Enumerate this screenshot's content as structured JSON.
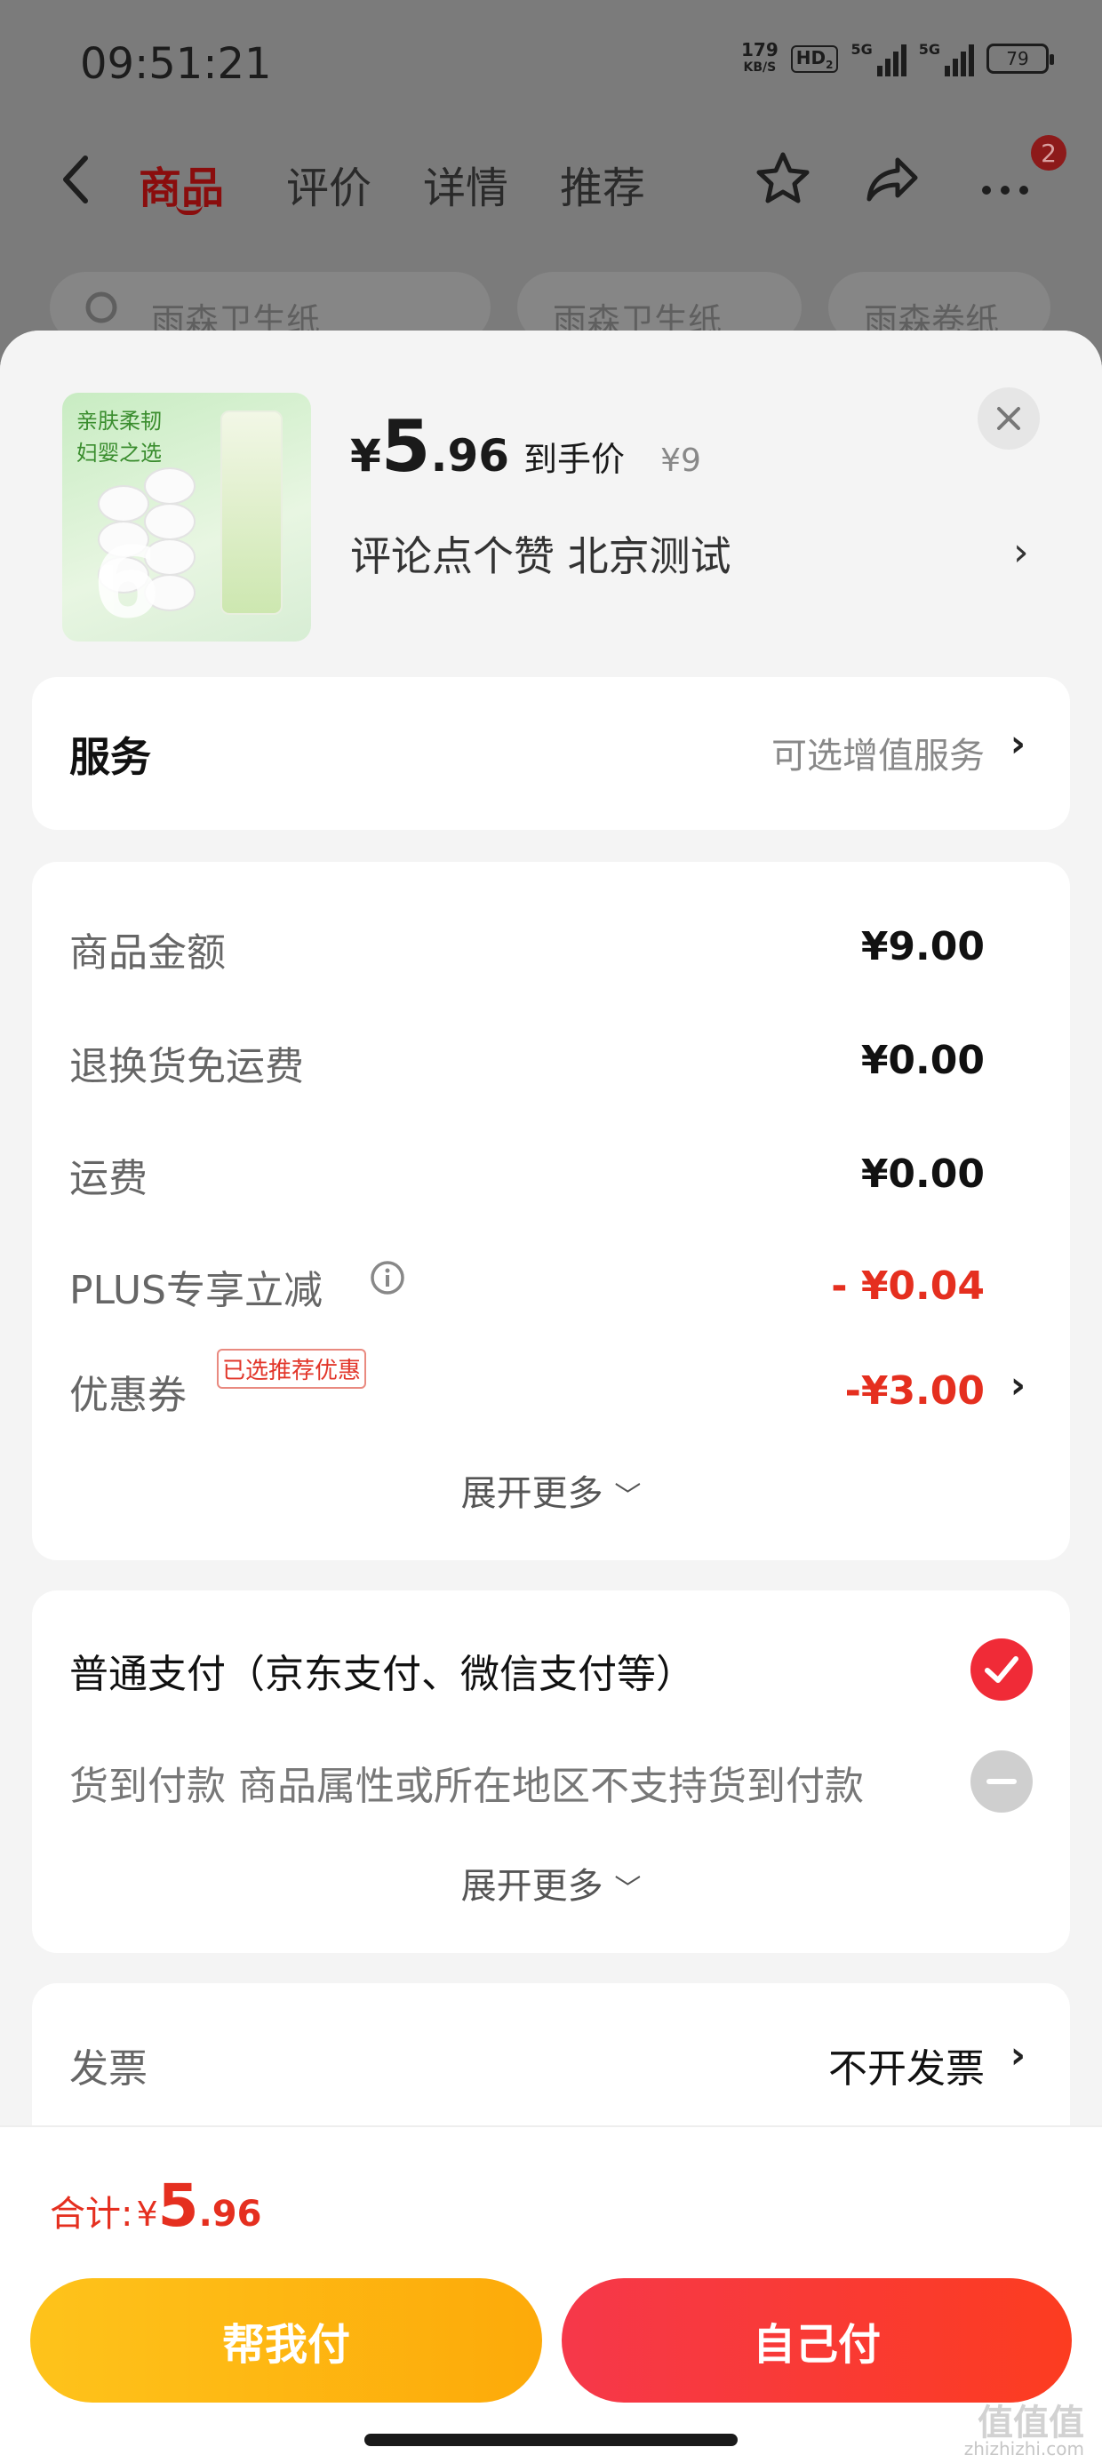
{
  "status_bar": {
    "time": "09:51:21",
    "net_speed": "179",
    "net_unit": "KB/S",
    "hd": "HD",
    "hd_sub": "2",
    "sim1": "5G",
    "sim2": "5G",
    "battery": "79"
  },
  "nav": {
    "tabs": [
      "商品",
      "评价",
      "详情",
      "推荐"
    ],
    "badge": "2"
  },
  "bg_chips": [
    "雨森卫生纸",
    "雨森卫生纸",
    "雨森卷纸"
  ],
  "product": {
    "thumb_text1": "亲肤柔韧",
    "thumb_text2": "妇婴之选",
    "thumb_number": "6",
    "price_symbol": "¥",
    "price_int": "5",
    "price_dec": ".96",
    "price_label": "到手价",
    "orig_price": "¥9",
    "subtitle": "评论点个赞  北京测试"
  },
  "service": {
    "title": "服务",
    "value": "可选增值服务"
  },
  "amounts": {
    "rows": [
      {
        "label": "商品金额",
        "value": "¥9.00"
      },
      {
        "label": "退换货免运费",
        "value": "¥0.00"
      },
      {
        "label": "运费",
        "value": "¥0.00"
      },
      {
        "label": "PLUS专享立减",
        "value": "- ¥0.04"
      },
      {
        "label": "优惠券",
        "value": "-¥3.00",
        "tag": "已选推荐优惠"
      }
    ],
    "expand": "展开更多"
  },
  "payment": {
    "normal": "普通支付（京东支付、微信支付等）",
    "cod": "货到付款 商品属性或所在地区不支持货到付款",
    "expand": "展开更多"
  },
  "invoice": {
    "label": "发票",
    "value": "不开发票"
  },
  "footer": {
    "total_label": "合计:",
    "total_symbol": "¥",
    "total_int": "5",
    "total_dec": ".96",
    "help_pay": "帮我付",
    "self_pay": "自己付",
    "watermark": "值值值",
    "watermark_url": "zhizhizhi.com"
  },
  "colors": {
    "accent_red": "#e52f1f",
    "pay_red": "#f6384a",
    "pay_yellow": "#fec31b"
  }
}
